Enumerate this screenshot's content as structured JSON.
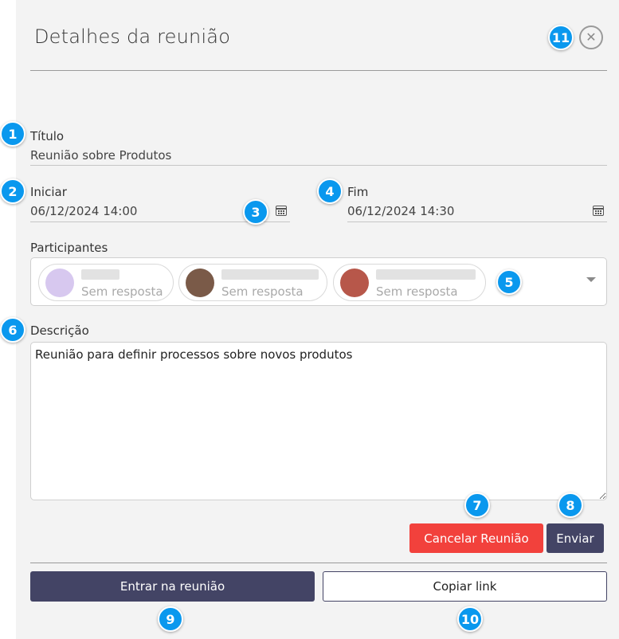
{
  "header": {
    "title": "Detalhes da reunião",
    "close_icon": "close-icon"
  },
  "fields": {
    "title": {
      "label": "Título",
      "value": "Reunião sobre Produtos"
    },
    "start": {
      "label": "Iniciar",
      "value": "06/12/2024 14:00",
      "icon": "calendar-icon"
    },
    "end": {
      "label": "Fim",
      "value": "06/12/2024 14:30",
      "icon": "calendar-icon"
    },
    "participants": {
      "label": "Participantes",
      "items": [
        {
          "status": "Sem resposta",
          "avatar_color": "#d7c8ef"
        },
        {
          "status": "Sem resposta",
          "avatar_color": "#7a5a48"
        },
        {
          "status": "Sem resposta",
          "avatar_color": "#b7574a"
        }
      ],
      "dropdown_icon": "chevron-down-icon"
    },
    "description": {
      "label": "Descrição",
      "value": "Reunião para definir processos sobre novos produtos"
    }
  },
  "actions": {
    "cancel_label": "Cancelar Reunião",
    "send_label": "Enviar",
    "join_label": "Entrar na reunião",
    "copy_label": "Copiar link"
  },
  "badges": [
    "1",
    "2",
    "3",
    "4",
    "5",
    "6",
    "7",
    "8",
    "9",
    "10",
    "11"
  ],
  "colors": {
    "primary": "#434465",
    "danger": "#f2413c",
    "badge": "#0a98ee",
    "panel": "#f3f3f3"
  }
}
